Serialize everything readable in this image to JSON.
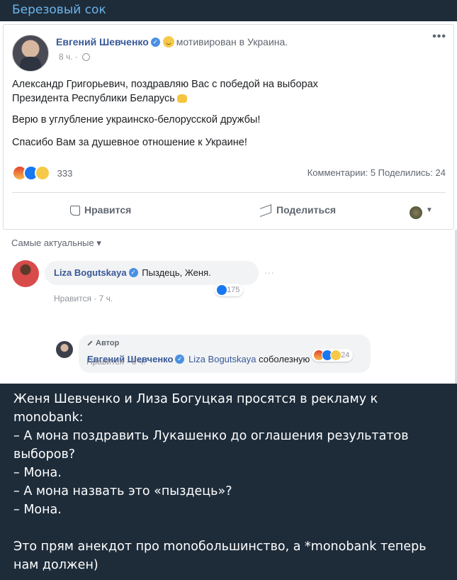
{
  "channel": {
    "title": "Березовый сок"
  },
  "post": {
    "author": "Евгений Шевченко",
    "feeling": "мотивирован в Украина.",
    "time": "8 ч.",
    "paragraphs": [
      "Александр Григорьевич, поздравляю Вас с победой на выборах",
      "Президента Республики Беларусь",
      "Верю в углубление украинско-белорусской дружбы!",
      "Спасибо Вам за душевное отношение к Украине!"
    ],
    "reaction_count": "333",
    "stats": "Комментарии: 5  Поделились: 24",
    "like_label": "Нравится",
    "share_label": "Поделиться"
  },
  "comments": {
    "sort_label": "Самые актуальные",
    "items": [
      {
        "author": "Liza Bogutskaya",
        "text": "Пыздець, Женя.",
        "meta": "Нравится · 7 ч.",
        "reactions": "175"
      },
      {
        "badge": "Автор",
        "author": "Евгений Шевченко",
        "mention": "Liza Bogutskaya",
        "text": "соболезную",
        "meta": "Нравится · 6 ч.",
        "reactions": "24"
      }
    ]
  },
  "caption": {
    "lines": [
      "Женя Шевченко и Лиза Богуцкая просятся в рекламу к",
      "monobank:",
      "– А мона поздравить Лукашенко до оглашения результатов",
      "выборов?",
      "– Мона.",
      "– А мона назвать это «пыздець»?",
      "– Мона.",
      "",
      "Это прям анекдот про monoбольшинство, а *monobank теперь",
      "нам должен)"
    ]
  },
  "colors": {
    "background": "#1e2c3a",
    "channel_title": "#6cb5ea",
    "fb_link": "#385898"
  }
}
